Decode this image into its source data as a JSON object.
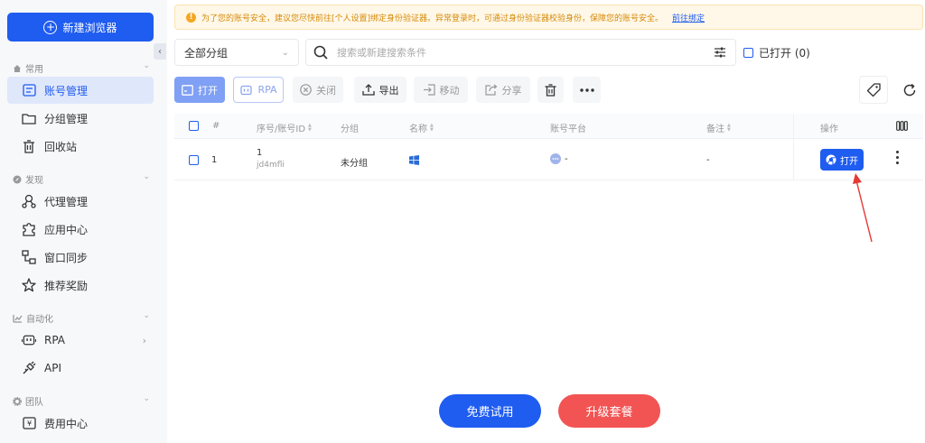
{
  "sidebar": {
    "new_browser": "新建浏览器",
    "sections": [
      {
        "label": "常用",
        "icon": "home-icon"
      },
      {
        "label": "发现",
        "icon": "compass-icon"
      },
      {
        "label": "自动化",
        "icon": "automation-icon"
      },
      {
        "label": "团队",
        "icon": "gear-icon"
      }
    ],
    "items": [
      {
        "label": "账号管理",
        "icon": "account-list-icon",
        "active": true
      },
      {
        "label": "分组管理",
        "icon": "folder-icon"
      },
      {
        "label": "回收站",
        "icon": "trash-icon"
      },
      {
        "label": "代理管理",
        "icon": "proxy-icon"
      },
      {
        "label": "应用中心",
        "icon": "puzzle-icon"
      },
      {
        "label": "窗口同步",
        "icon": "window-sync-icon"
      },
      {
        "label": "推荐奖励",
        "icon": "star-icon"
      },
      {
        "label": "RPA",
        "icon": "robot-icon"
      },
      {
        "label": "API",
        "icon": "api-icon"
      },
      {
        "label": "费用中心",
        "icon": "billing-icon"
      }
    ]
  },
  "notice": {
    "text": "为了您的账号安全，建议您尽快前往[个人设置]绑定身份验证器。异常登录时，可通过身份验证器校验身份，保障您的账号安全。",
    "link": "前往绑定"
  },
  "filter": {
    "group_value": "全部分组",
    "search_placeholder": "搜索或新建搜索条件",
    "opened_label": "已打开 (0)"
  },
  "toolbar": {
    "open": "打开",
    "rpa": "RPA",
    "close": "关闭",
    "export": "导出",
    "move": "移动",
    "share": "分享"
  },
  "table": {
    "headers": {
      "index": "#",
      "id": "序号/账号ID",
      "group": "分组",
      "name": "名称",
      "platform": "账号平台",
      "remark": "备注",
      "action": "操作"
    },
    "rows": [
      {
        "index": "1",
        "seq": "1",
        "account_id": "jd4mfli",
        "group": "未分组",
        "platform": "-",
        "remark": "-",
        "action": "打开"
      }
    ]
  },
  "bottom": {
    "trial": "免费试用",
    "upgrade": "升级套餐"
  },
  "colors": {
    "primary": "#1f5cf0",
    "danger": "#f25454",
    "warning": "#f5a623",
    "annotation": "#e53935"
  }
}
